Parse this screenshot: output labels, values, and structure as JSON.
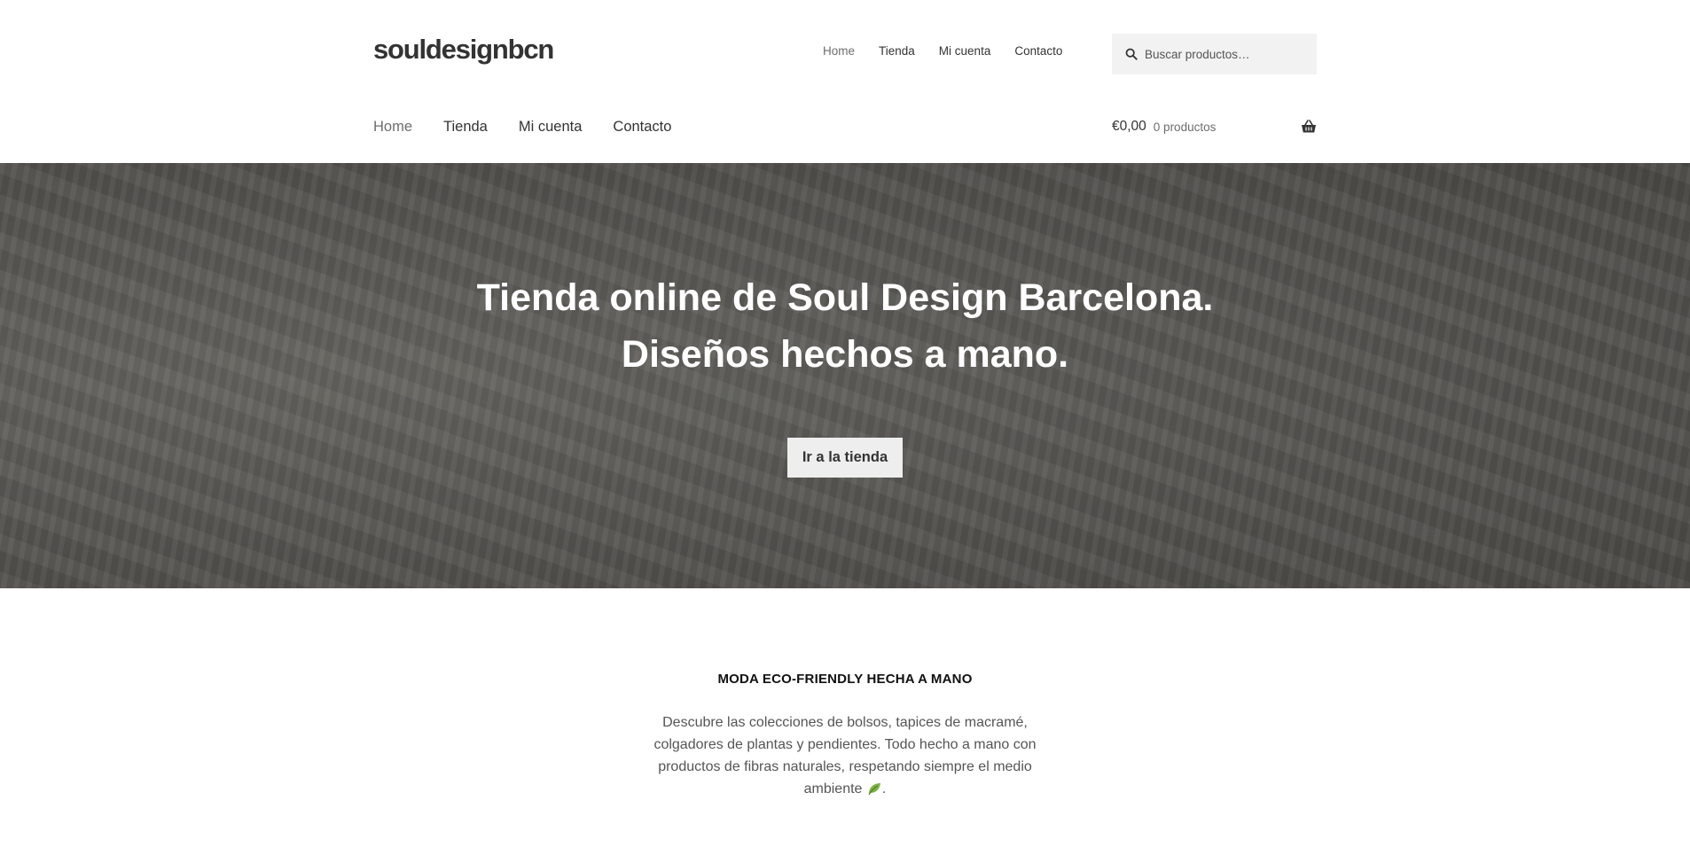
{
  "site": {
    "logo": "souldesignbcn"
  },
  "secondary_nav": {
    "items": [
      "Home",
      "Tienda",
      "Mi cuenta",
      "Contacto"
    ]
  },
  "search": {
    "placeholder": "Buscar productos…",
    "icon": "search-icon"
  },
  "primary_nav": {
    "items": [
      "Home",
      "Tienda",
      "Mi cuenta",
      "Contacto"
    ]
  },
  "cart": {
    "amount": "€0,00",
    "count": "0 productos",
    "icon": "basket-icon"
  },
  "hero": {
    "line1": "Tienda online de Soul Design Barcelona.",
    "line2": "Diseños hechos a mano.",
    "button": "Ir a la tienda"
  },
  "intro": {
    "heading": "MODA ECO-FRIENDLY HECHA A MANO",
    "text": "Descubre las colecciones de bolsos, tapices de macramé, colgadores de plantas y pendientes. Todo hecho a mano con productos de fibras naturales, respetando siempre el medio ambiente",
    "suffix": ".",
    "emoji": "leaf-icon"
  },
  "colors": {
    "accent_text": "#333333",
    "muted": "#6d6d6d",
    "hero_overlay": "#2a2a26"
  }
}
